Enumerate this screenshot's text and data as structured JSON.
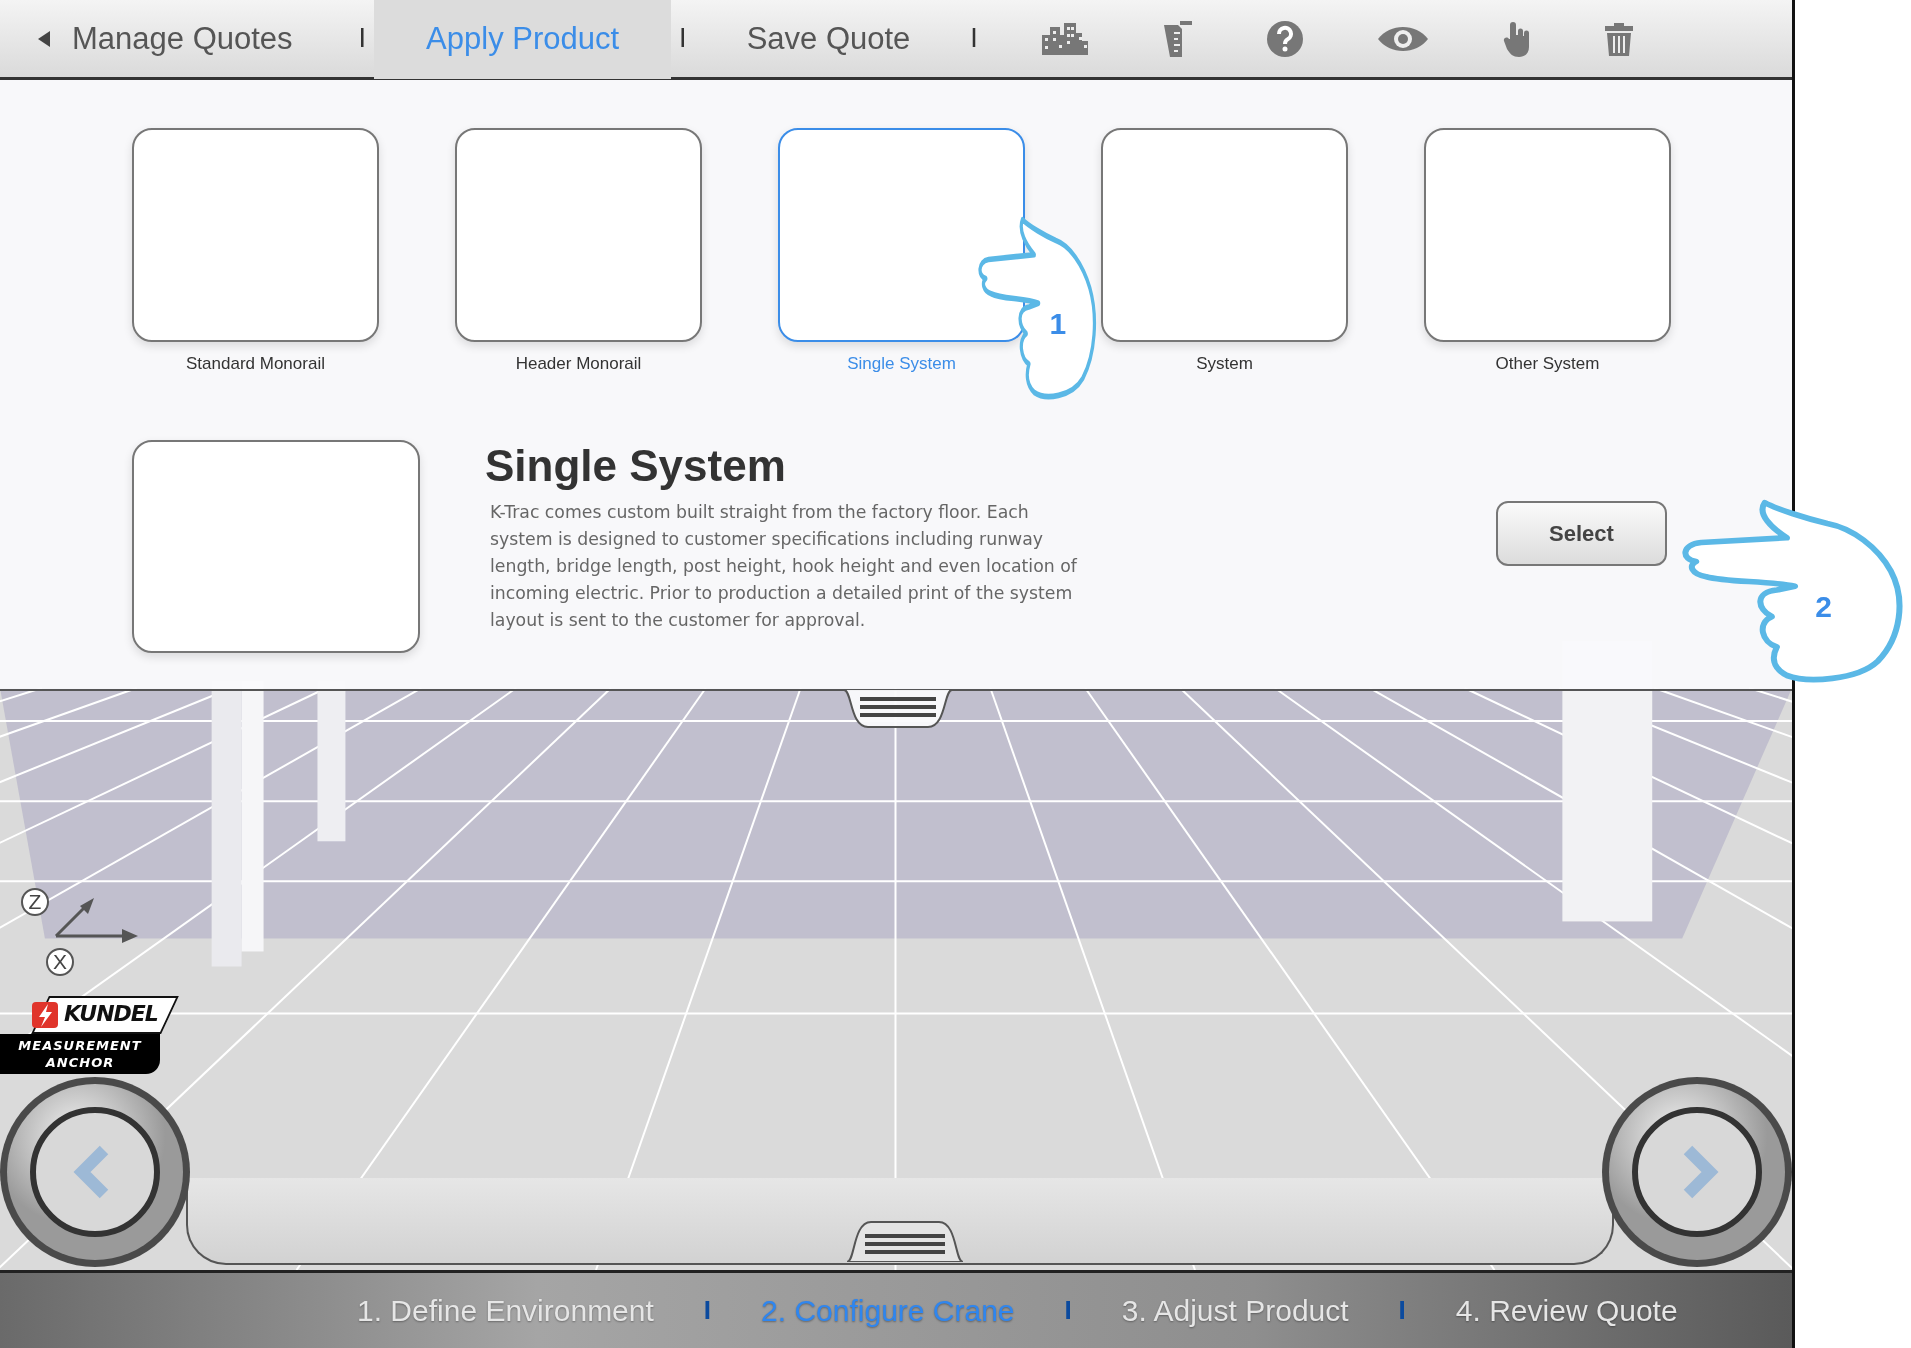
{
  "toolbar": {
    "items": [
      {
        "kind": "back",
        "label": "Manage Quotes"
      },
      {
        "kind": "separator",
        "label": "I"
      },
      {
        "kind": "tab",
        "label": "Apply Product",
        "selected": true
      },
      {
        "kind": "separator",
        "label": "I"
      },
      {
        "kind": "tab",
        "label": "Save Quote",
        "selected": false
      },
      {
        "kind": "separator",
        "label": "I"
      }
    ]
  },
  "products": [
    {
      "label": "Standard Monorail",
      "selected": false
    },
    {
      "label": "Header Monorail",
      "selected": false
    },
    {
      "label": "Single System",
      "selected": true
    },
    {
      "label": "System",
      "selected": false
    },
    {
      "label": "Other System",
      "selected": false
    }
  ],
  "detail": {
    "title": "Single System",
    "description": "K-Trac comes custom built straight from the factory floor. Each system is designed to customer specifications including runway length, bridge length, post height, hook height and even location of incoming electric. Prior to production a detailed print of the system layout is sent to the customer for approval.",
    "button": "Select"
  },
  "axes": {
    "z": "Z",
    "x": "X"
  },
  "logo": {
    "name": "KUNDEL",
    "caption": "MEASUREMENT ANCHOR"
  },
  "steps": [
    {
      "kind": "step",
      "label": "1. Define Environment",
      "selected": false
    },
    {
      "kind": "separator",
      "label": "I"
    },
    {
      "kind": "step",
      "label": "2. Configure Crane",
      "selected": true
    },
    {
      "kind": "separator",
      "label": "I"
    },
    {
      "kind": "step",
      "label": "3. Adjust Product",
      "selected": false
    },
    {
      "kind": "separator",
      "label": "I"
    },
    {
      "kind": "step",
      "label": "4. Review Quote",
      "selected": false
    }
  ],
  "annotations": [
    {
      "number": "1"
    },
    {
      "number": "2"
    }
  ]
}
